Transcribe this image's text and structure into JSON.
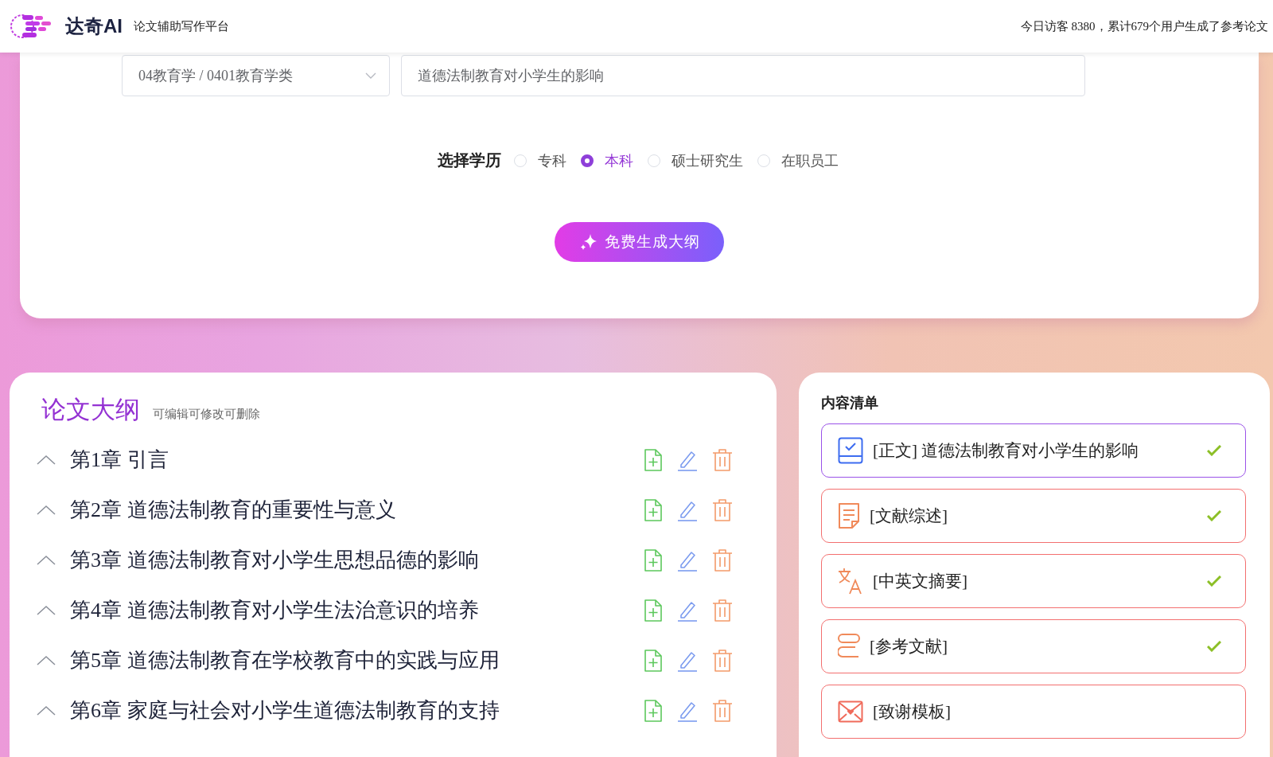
{
  "header": {
    "brand": "达奇AI",
    "tagline": "论文辅助写作平台",
    "stats": "今日访客 8380，累计679个用户生成了参考论文"
  },
  "form": {
    "subject": {
      "value": "04教育学 / 0401教育学类"
    },
    "title_field": {
      "value": "道德法制教育对小学生的影响"
    },
    "degree_label": "选择学历",
    "degrees": [
      {
        "label": "专科",
        "selected": false
      },
      {
        "label": "本科",
        "selected": true
      },
      {
        "label": "硕士研究生",
        "selected": false
      },
      {
        "label": "在职员工",
        "selected": false
      }
    ],
    "generate_button": "免费生成大纲"
  },
  "outline": {
    "title": "论文大纲",
    "hint": "可编辑可修改可删除",
    "chapters": [
      {
        "title": "第1章 引言",
        "expanded": true
      },
      {
        "title": "第2章 道德法制教育的重要性与意义",
        "expanded": true
      },
      {
        "title": "第3章 道德法制教育对小学生思想品德的影响",
        "expanded": true
      },
      {
        "title": "第4章 道德法制教育对小学生法治意识的培养",
        "expanded": true
      },
      {
        "title": "第5章 道德法制教育在学校教育中的实践与应用",
        "expanded": true
      },
      {
        "title": "第6章 家庭与社会对小学生道德法制教育的支持",
        "expanded": true
      }
    ]
  },
  "contents": {
    "title": "内容清单",
    "items": [
      {
        "kind": "main",
        "label": "[正文] 道德法制教育对小学生的影响",
        "selected": true,
        "checked": true
      },
      {
        "kind": "review",
        "label": "[文献综述]",
        "selected": false,
        "checked": true
      },
      {
        "kind": "abstract",
        "label": "[中英文摘要]",
        "selected": false,
        "checked": true
      },
      {
        "kind": "references",
        "label": "[参考文献]",
        "selected": false,
        "checked": true
      },
      {
        "kind": "thanks",
        "label": "[致谢模板]",
        "selected": false,
        "checked": false
      }
    ]
  }
}
